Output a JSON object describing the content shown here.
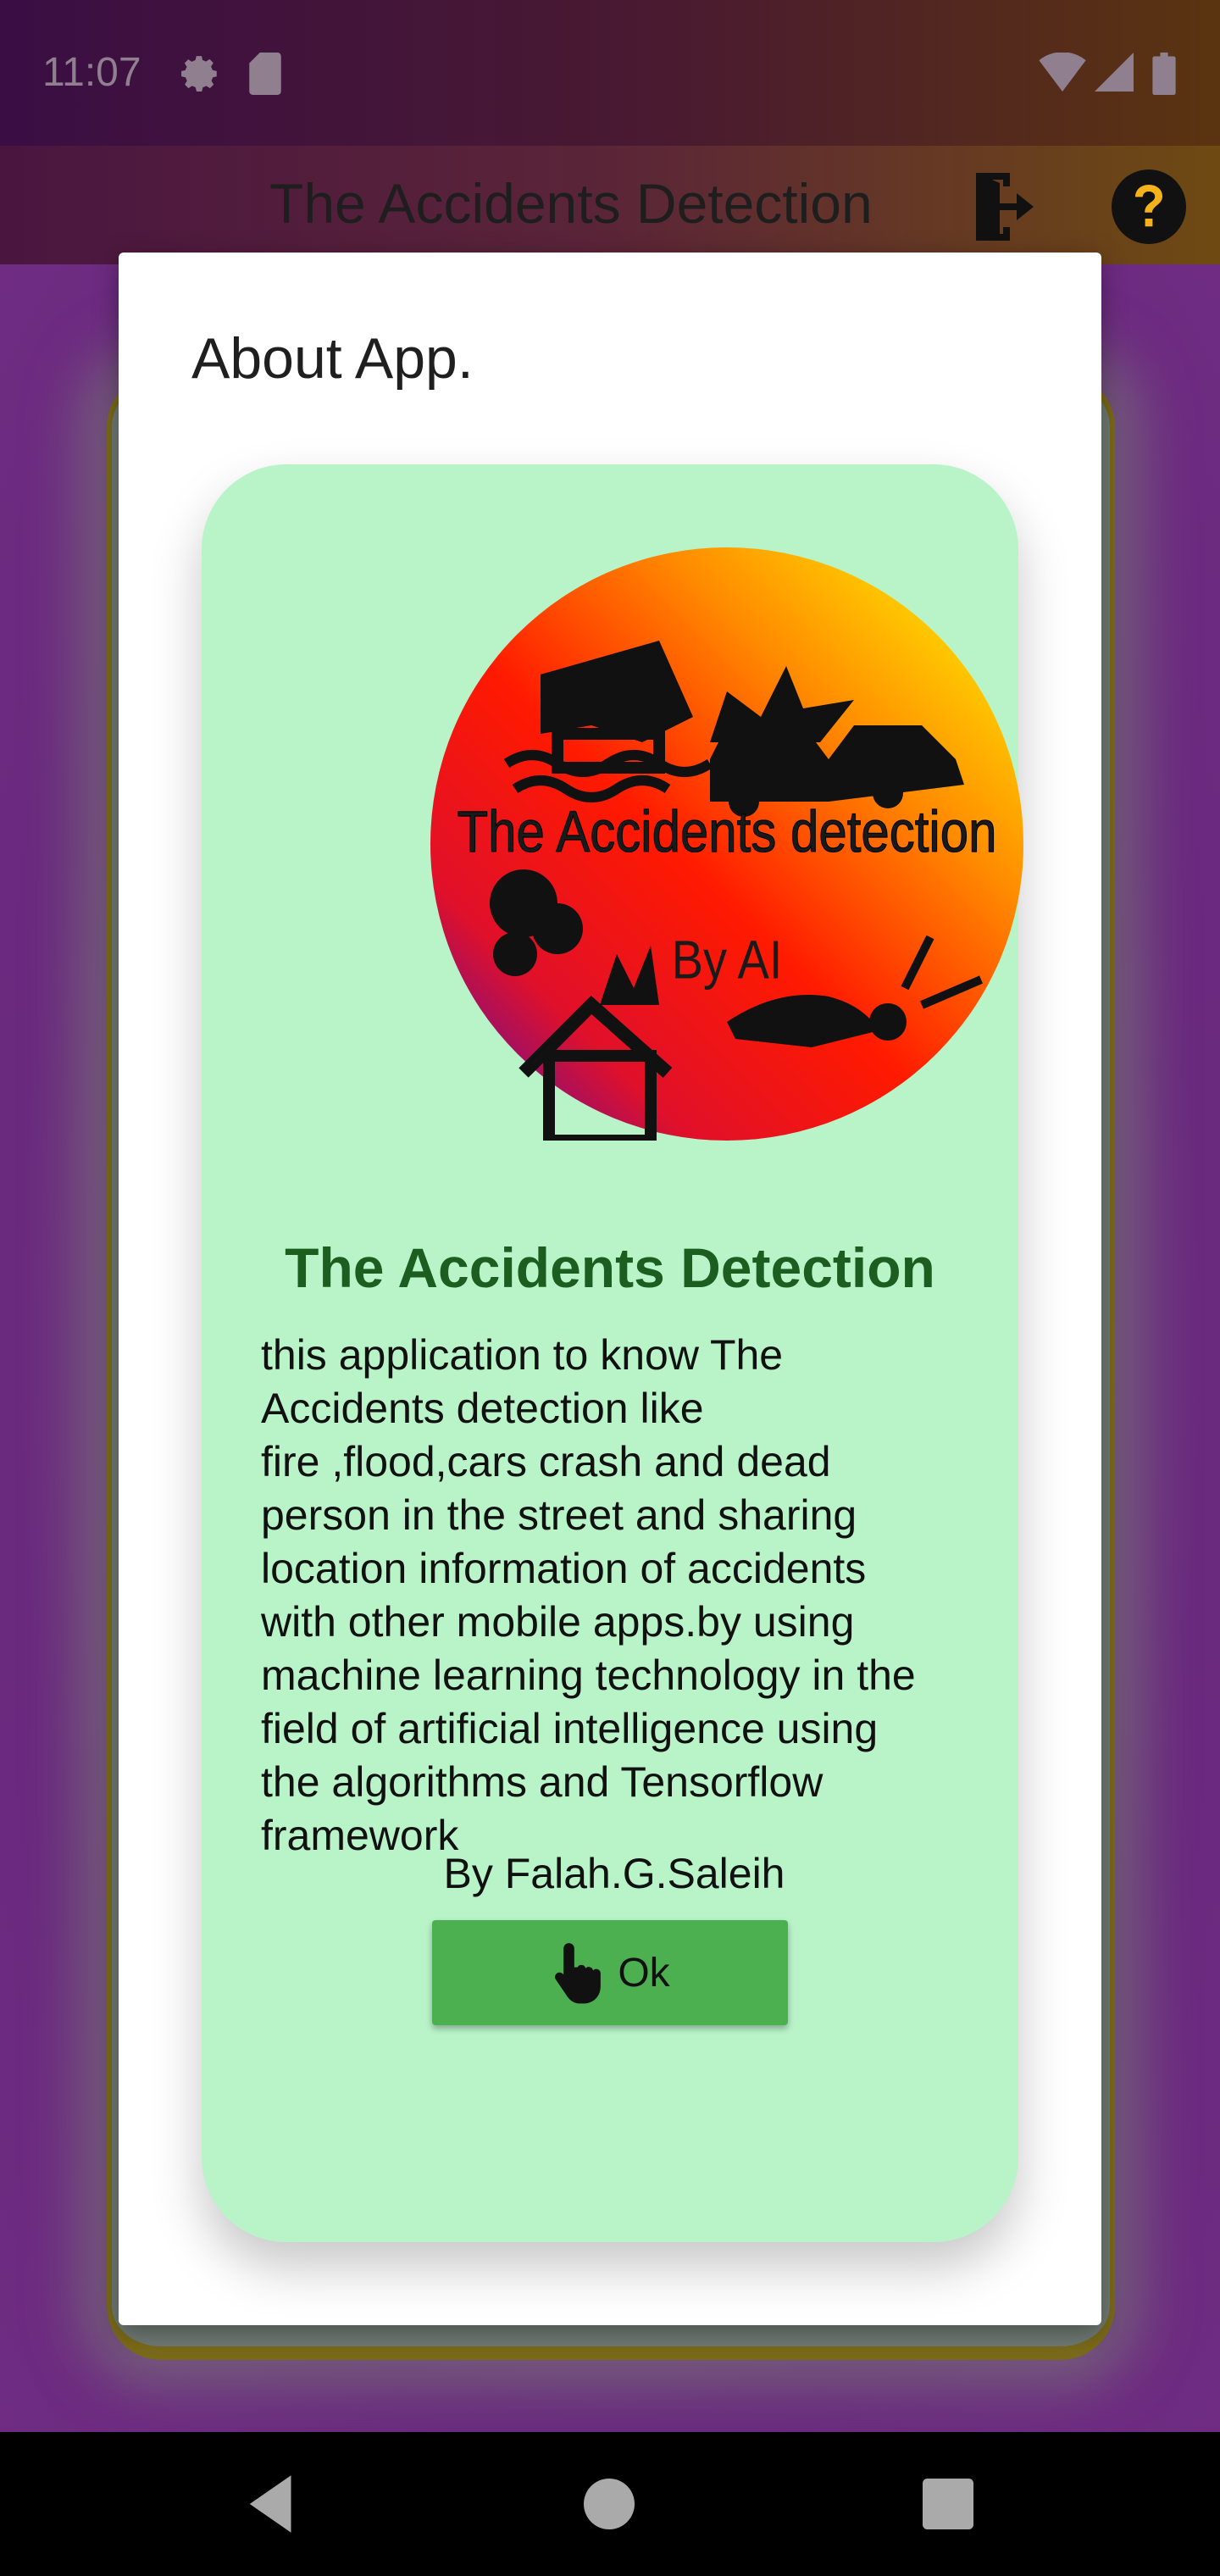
{
  "status_bar": {
    "time": "11:07",
    "icons": [
      "settings-icon",
      "sd-card-icon",
      "wifi-icon",
      "signal-icon",
      "battery-icon"
    ]
  },
  "app_bar": {
    "title": "The Accidents Detection",
    "actions": [
      "exit-icon",
      "help-icon"
    ]
  },
  "dialog": {
    "title": "About App.",
    "logo": {
      "line1": "The Accidents detection",
      "line2": "By AI"
    },
    "heading": "The Accidents Detection",
    "description": "this application to know The\nAccidents detection like\nfire ,flood,cars crash and dead\nperson in the street and sharing\nlocation information of accidents\nwith other mobile apps.by using\nmachine learning technology in the\nfield of artificial intelligence using\nthe algorithms and Tensorflow\nframework",
    "author": "By Falah.G.Saleih",
    "ok_label": "Ok"
  },
  "nav_bar": {
    "buttons": [
      "back-icon",
      "home-icon",
      "recents-icon"
    ]
  },
  "colors": {
    "panel_bg": "#b9f4c9",
    "heading": "#1b5e20",
    "ok_button": "#4caf50",
    "backdrop": "#6a2a80"
  }
}
